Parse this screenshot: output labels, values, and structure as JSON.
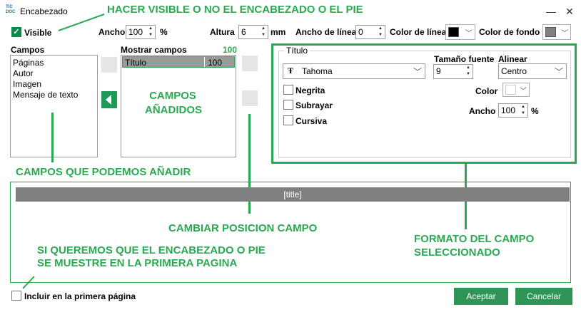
{
  "window": {
    "title": "Encabezado",
    "icon_text": "TIC DOC",
    "minimize": "—",
    "close": "✕"
  },
  "toolbar": {
    "visible_label": "Visible",
    "ancho_label": "Ancho",
    "ancho_value": "100",
    "ancho_unit": "%",
    "altura_label": "Altura",
    "altura_value": "6",
    "altura_unit": "mm",
    "ancho_linea_label": "Ancho de línea",
    "ancho_linea_value": "0",
    "color_linea_label": "Color de línea",
    "color_linea": "#000000",
    "color_fondo_label": "Color de fondo",
    "color_fondo": "#808080"
  },
  "campos": {
    "label": "Campos",
    "items": [
      "Páginas",
      "Autor",
      "Imagen",
      "Mensaje de texto"
    ]
  },
  "mostrar": {
    "label": "Mostrar campos",
    "count": "100",
    "rows": [
      {
        "name": "Título",
        "width": "100"
      }
    ]
  },
  "format": {
    "group_label": "Título",
    "font_label": "Tamaño fuente",
    "font_name": "Tahoma",
    "font_size": "9",
    "align_label": "Alinear",
    "align_value": "Centro",
    "negrita": "Negrita",
    "subrayar": "Subrayar",
    "cursiva": "Cursiva",
    "color_label": "Color",
    "ancho_label": "Ancho",
    "ancho_value": "100",
    "ancho_unit": "%"
  },
  "preview": {
    "text": "[title]"
  },
  "footer": {
    "incluir_label": "Incluir en la primera página",
    "aceptar": "Aceptar",
    "cancelar": "Cancelar"
  },
  "annotations": {
    "hacer_visible": "HACER VISIBLE O NO EL ENCABEZADO O EL PIE",
    "campos_anadidos_1": "CAMPOS",
    "campos_anadidos_2": "AÑADIDOS",
    "campos_podemos": "CAMPOS QUE PODEMOS AÑADIR",
    "cambiar_posicion": "CAMBIAR POSICION CAMPO",
    "formato_1": "FORMATO DEL CAMPO",
    "formato_2": "SELECCIONADO",
    "primera_1": "SI QUEREMOS QUE EL ENCABEZADO O PIE",
    "primera_2": "SE MUESTRE EN LA PRIMERA PAGINA"
  },
  "colors": {
    "accent_green": "#2aa952",
    "button_green": "#2e9557"
  }
}
